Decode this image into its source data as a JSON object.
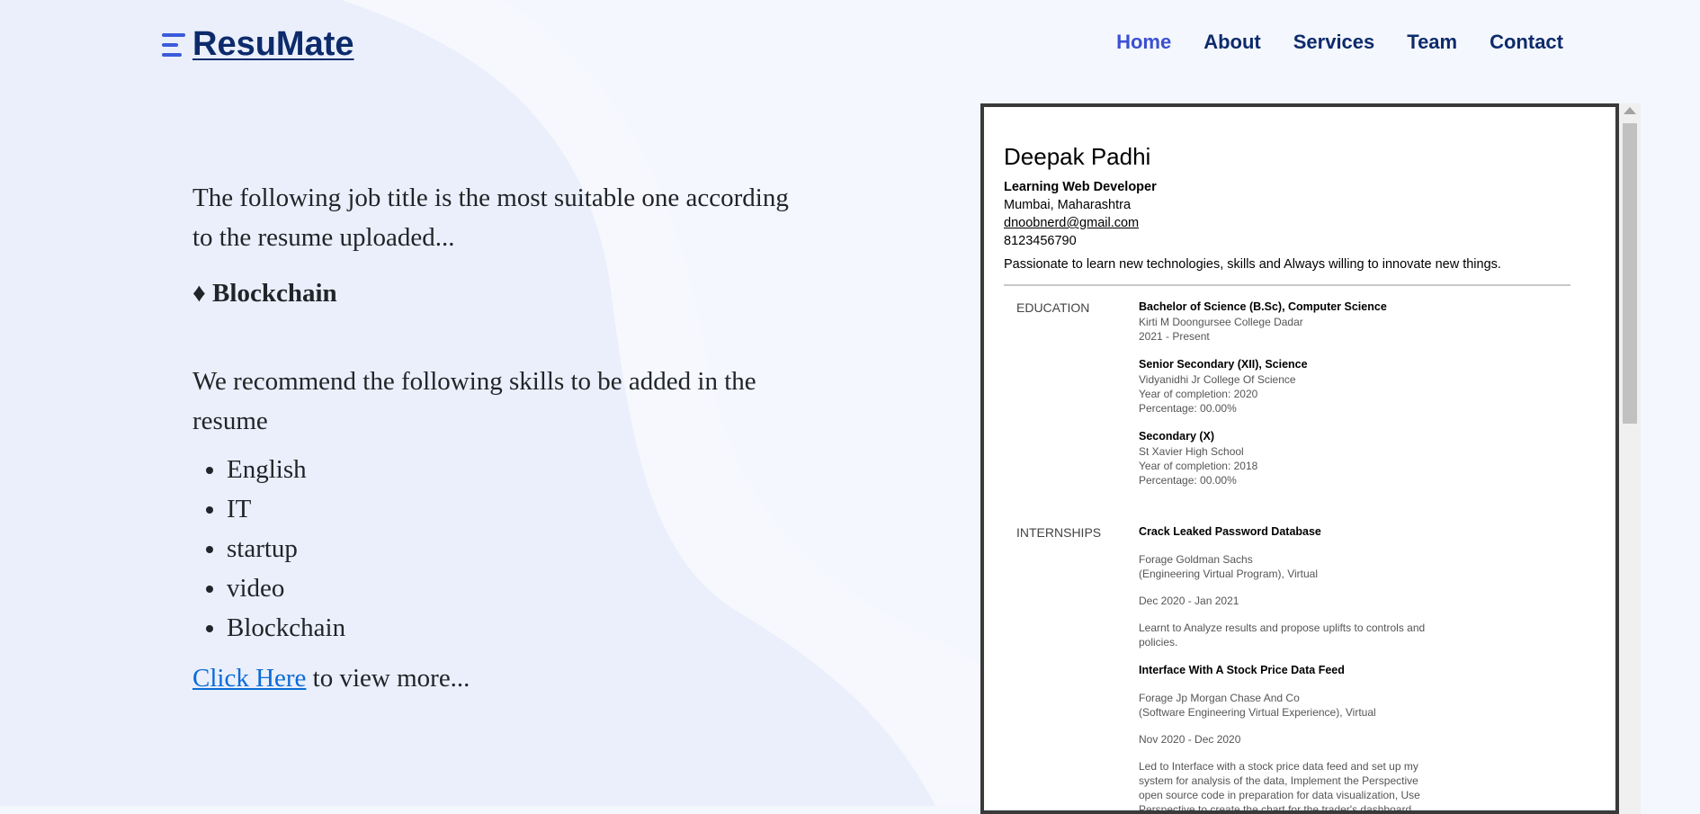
{
  "header": {
    "logo": "ResuMate",
    "nav": [
      {
        "label": "Home",
        "active": true
      },
      {
        "label": "About",
        "active": false
      },
      {
        "label": "Services",
        "active": false
      },
      {
        "label": "Team",
        "active": false
      },
      {
        "label": "Contact",
        "active": false
      }
    ]
  },
  "main": {
    "intro": "The following job title is the most suitable one according to the resume uploaded...",
    "job_title": "♦ Blockchain",
    "recommend_text": "We recommend the following skills to be added in the resume",
    "skills": [
      "English",
      "IT",
      "startup",
      "video",
      "Blockchain"
    ],
    "link_text": "Click Here",
    "link_suffix": " to view more..."
  },
  "resume": {
    "name": "Deepak Padhi",
    "title": "Learning Web Developer",
    "location": "Mumbai, Maharashtra",
    "email": "dnoobnerd@gmail.com",
    "phone": "8123456790",
    "summary": "Passionate to learn new technologies, skills and Always willing to innovate new things.",
    "education_label": "EDUCATION",
    "education": [
      {
        "title": "Bachelor of Science (B.Sc), Computer Science",
        "lines": [
          "Kirti M Doongursee College Dadar",
          "2021 - Present"
        ]
      },
      {
        "title": "Senior Secondary (XII), Science",
        "lines": [
          "Vidyanidhi Jr College Of Science",
          "Year of completion: 2020",
          "Percentage: 00.00%"
        ]
      },
      {
        "title": "Secondary (X)",
        "lines": [
          "St Xavier High School",
          "Year of completion: 2018",
          "Percentage: 00.00%"
        ]
      }
    ],
    "internships_label": "INTERNSHIPS",
    "internships": [
      {
        "title": "Crack Leaked Password Database",
        "org": [
          "Forage Goldman Sachs",
          "(Engineering Virtual Program), Virtual"
        ],
        "dates": "Dec 2020 - Jan 2021",
        "desc": [
          "Learnt to Analyze results and propose uplifts to controls and",
          "policies."
        ]
      },
      {
        "title": "Interface With A Stock Price Data Feed",
        "org": [
          "Forage Jp Morgan Chase And Co",
          "(Software Engineering Virtual Experience), Virtual"
        ],
        "dates": "Nov 2020 - Dec 2020",
        "desc": [
          "Led to Interface with a stock price data feed and set up my",
          "system for analysis of the data, Implement the Perspective",
          "open source code in preparation for data visualization, Use",
          "Perspective to create the chart for the trader's dashboard."
        ]
      }
    ]
  }
}
